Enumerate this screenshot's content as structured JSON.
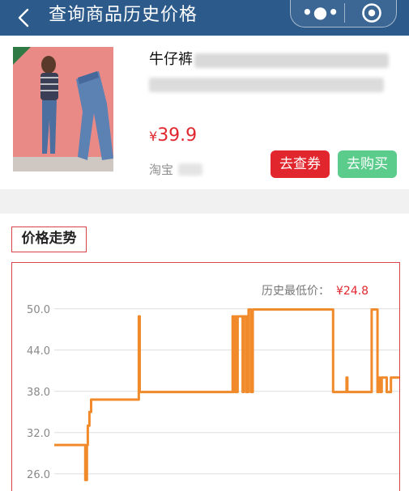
{
  "nav": {
    "title": "查询商品历史价格",
    "more_glyph": "•●•"
  },
  "product": {
    "name": "牛仔裤",
    "price_symbol": "¥",
    "price": "39.9",
    "shop": "淘宝",
    "coupon_button": "去查券",
    "buy_button": "去购买"
  },
  "trend": {
    "title": "价格走势"
  },
  "colors": {
    "nav_bg": "#2c5a8a",
    "accent_red": "#e2262d",
    "buy_green": "#5ccc8d",
    "line": "#f08a2a"
  },
  "chart_data": {
    "type": "line",
    "annotation_label": "历史最低价：",
    "annotation_value": "¥24.8",
    "yticks": [
      "50.0",
      "44.0",
      "38.0",
      "32.0",
      "26.0"
    ],
    "ylim": [
      23.5,
      50.8
    ],
    "grid": true,
    "series": [
      {
        "x": [
          0,
          37,
          37,
          39,
          39,
          40,
          40,
          42,
          42,
          44,
          44,
          50,
          50,
          53,
          53,
          101,
          101,
          102,
          102,
          104,
          104,
          213,
          213,
          214,
          214,
          216,
          216,
          217,
          217,
          219,
          219,
          220,
          220,
          225,
          225,
          226,
          226,
          229,
          229,
          230,
          230,
          231,
          231,
          232,
          232,
          235,
          235,
          237,
          237,
          333,
          333,
          349,
          349,
          350,
          350,
          351,
          351,
          379,
          379,
          386,
          386,
          387,
          387,
          389,
          389,
          391,
          391,
          397,
          397,
          402,
          402,
          412
        ],
        "y": [
          30.2,
          30.2,
          25.1,
          25.1,
          30.2,
          30.2,
          33,
          33,
          35,
          35,
          36.8,
          36.8,
          36.8,
          36.8,
          36.8,
          36.8,
          48.9,
          48.9,
          37.9,
          37.9,
          37.9,
          37.9,
          48.9,
          48.9,
          37.9,
          37.9,
          48.9,
          48.9,
          37.9,
          37.9,
          48.9,
          48.9,
          48.9,
          48.9,
          37.9,
          37.9,
          48.9,
          48.9,
          37.9,
          37.9,
          48.9,
          48.9,
          37.9,
          37.9,
          49.9,
          49.9,
          37.9,
          37.9,
          49.9,
          49.9,
          37.9,
          37.9,
          40,
          40,
          37.9,
          37.9,
          37.9,
          37.9,
          49.9,
          49.9,
          37.9,
          37.9,
          40,
          40,
          37.9,
          37.9,
          40,
          40,
          37.9,
          37.9,
          40,
          40
        ]
      }
    ]
  }
}
